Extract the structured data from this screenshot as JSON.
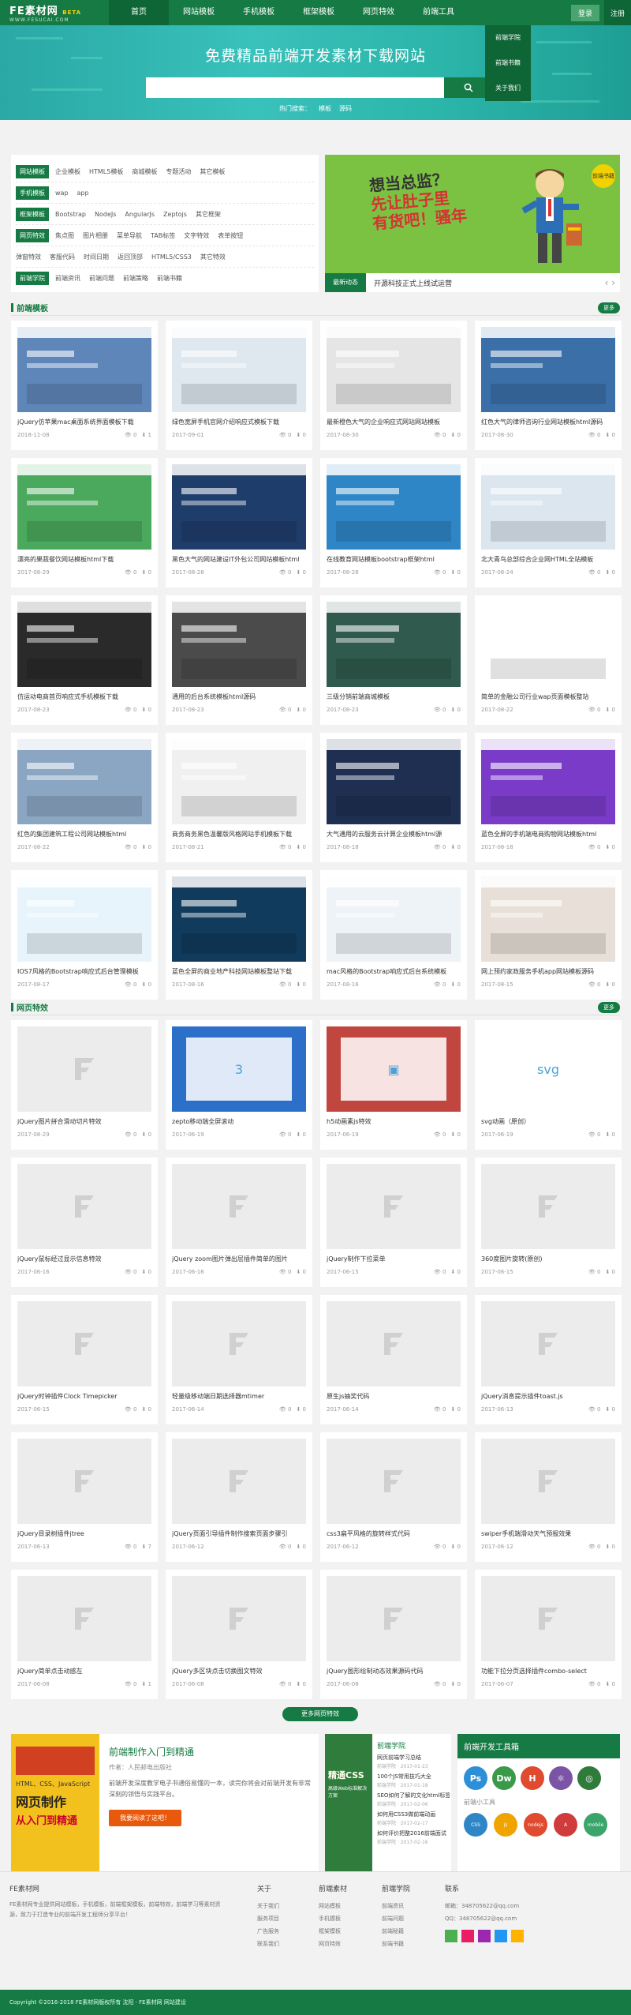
{
  "header": {
    "logo_main": "FE素材网",
    "logo_badge": "BETA",
    "logo_sub": "WWW.FESUCAI.COM",
    "nav": [
      "首页",
      "网站模板",
      "手机模板",
      "框架模板",
      "网页特效",
      "前端工具"
    ],
    "login": "登录",
    "register": "注册",
    "dropdown": [
      "前端学院",
      "前端书籍",
      "关于我们"
    ]
  },
  "banner": {
    "title": "免费精品前端开发素材下载网站",
    "search_placeholder": "",
    "hot_label": "热门搜索：",
    "hot": [
      "模板",
      "源码"
    ]
  },
  "tags": {
    "r1_label": "网站模板",
    "r1": [
      "企业模板",
      "HTML5模板",
      "商城模板",
      "专题活动",
      "其它模板"
    ],
    "r2_label": "手机模板",
    "r2": [
      "wap",
      "app"
    ],
    "r3_label": "框架模板",
    "r3": [
      "Bootstrap",
      "NodeJs",
      "AngularJs",
      "Zeptojs",
      "其它框架"
    ],
    "r4_label": "网页特效",
    "r4": [
      "焦点图",
      "图片相册",
      "菜单导航",
      "TAB标签",
      "文字特效",
      "表单按钮"
    ],
    "r5": [
      "弹窗特效",
      "客服代码",
      "时间日期",
      "返回顶部",
      "HTML5/CSS3",
      "其它特效"
    ],
    "r6_label": "前端学院",
    "r6": [
      "前端资讯",
      "前端问题",
      "前端策略",
      "前端书籍"
    ]
  },
  "promo": {
    "line1": "想当总监？",
    "line2": "先让肚子里",
    "line3": "有货吧！骚年",
    "badge": "前端书籍"
  },
  "news": {
    "label": "最新动态",
    "text": "开源科技正式上线试运营"
  },
  "sec1": {
    "title": "前端模板",
    "more": "更多"
  },
  "sec2": {
    "title": "网页特效",
    "more": "更多"
  },
  "templates": [
    {
      "t": "jQuery仿苹果mac桌面系统界面模板下载",
      "d": "2018-11-08",
      "v": "0",
      "l": "1",
      "c": "#5e86b8"
    },
    {
      "t": "绿色宽屏手机官网介绍响应式模板下载",
      "d": "2017-09-01",
      "v": "0",
      "l": "0",
      "c": "#dfe8ef"
    },
    {
      "t": "最新橙色大气的企业响应式网站网站模板",
      "d": "2017-08-30",
      "v": "0",
      "l": "0",
      "c": "#e5e5e5"
    },
    {
      "t": "红色大气的律师咨询行业网站模板html源码",
      "d": "2017-08-30",
      "v": "0",
      "l": "0",
      "c": "#3b6fa8"
    },
    {
      "t": "漂亮的果蔬餐饮网站模板html下载",
      "d": "2017-08-29",
      "v": "0",
      "l": "0",
      "c": "#4aa95c"
    },
    {
      "t": "黑色大气的网站建设IT外包公司网站模板html",
      "d": "2017-08-28",
      "v": "0",
      "l": "0",
      "c": "#1f3d6b"
    },
    {
      "t": "在线教育网站模板bootstrap框架html",
      "d": "2017-08-28",
      "v": "0",
      "l": "0",
      "c": "#2e86c7"
    },
    {
      "t": "北大青鸟总部综合企业网HTML全站模板",
      "d": "2017-08-24",
      "v": "0",
      "l": "0",
      "c": "#dce6ef"
    },
    {
      "t": "仿运动电商首页响应式手机模板下载",
      "d": "2017-08-23",
      "v": "0",
      "l": "0",
      "c": "#2a2a2a"
    },
    {
      "t": "通用的后台系统模板html源码",
      "d": "2017-08-23",
      "v": "0",
      "l": "0",
      "c": "#4b4b4b"
    },
    {
      "t": "三级分销前端商城模板",
      "d": "2017-08-23",
      "v": "0",
      "l": "0",
      "c": "#2f5a4d"
    },
    {
      "t": "简单的金融公司行业wap页面模板整站",
      "d": "2017-08-22",
      "v": "0",
      "l": "0",
      "c": "#ffffff"
    },
    {
      "t": "红色的集团建筑工程公司网站模板html",
      "d": "2017-08-22",
      "v": "0",
      "l": "0",
      "c": "#8aa6c2"
    },
    {
      "t": "商务商务黑色温馨版风格网站手机模板下载",
      "d": "2017-08-21",
      "v": "0",
      "l": "0",
      "c": "#f0f0f0"
    },
    {
      "t": "大气通用的云服务云计算企业模板html源",
      "d": "2017-08-18",
      "v": "0",
      "l": "0",
      "c": "#1e2f52"
    },
    {
      "t": "蓝色全屏的手机端电商购物网站模板html",
      "d": "2017-08-18",
      "v": "0",
      "l": "0",
      "c": "#7a3cc8"
    },
    {
      "t": "IOS7风格的Bootstrap响应式后台管理模板",
      "d": "2017-08-17",
      "v": "0",
      "l": "0",
      "c": "#e8f4fb"
    },
    {
      "t": "蓝色全屏的商业地产科技网站模板整站下载",
      "d": "2017-08-16",
      "v": "0",
      "l": "0",
      "c": "#113b5c"
    },
    {
      "t": "mac风格的Bootstrap响应式后台系统模板",
      "d": "2017-08-16",
      "v": "0",
      "l": "0",
      "c": "#eef3f8"
    },
    {
      "t": "网上预约家政服务手机app网站模板源码",
      "d": "2017-08-15",
      "v": "0",
      "l": "0",
      "c": "#e8e0d8"
    }
  ],
  "effects": [
    {
      "t": "jQuery图片拼合滑动切片特效",
      "d": "2017-08-29",
      "v": "0",
      "l": "0",
      "c": "#ececec",
      "ph": true
    },
    {
      "t": "zepto移动端全屏滚动",
      "d": "2017-06-19",
      "v": "0",
      "l": "0",
      "c": "#2b6fc9",
      "ph": false
    },
    {
      "t": "h5动画素js特效",
      "d": "2017-06-19",
      "v": "0",
      "l": "0",
      "c": "#c0463f",
      "ph": false
    },
    {
      "t": "svg动画（原创）",
      "d": "2017-06-19",
      "v": "0",
      "l": "0",
      "c": "#ffffff",
      "ph": false
    },
    {
      "t": "jQuery鼠标经过显示信息特效",
      "d": "2017-06-16",
      "v": "0",
      "l": "0",
      "c": "#ececec",
      "ph": true
    },
    {
      "t": "jQuery zoom图片弹出层插件简单的图片",
      "d": "2017-06-16",
      "v": "0",
      "l": "0",
      "c": "#ececec",
      "ph": true
    },
    {
      "t": "jQuery制作下拉菜单",
      "d": "2017-06-15",
      "v": "0",
      "l": "0",
      "c": "#ececec",
      "ph": true
    },
    {
      "t": "360度图片旋转(原创)",
      "d": "2017-06-15",
      "v": "0",
      "l": "0",
      "c": "#ececec",
      "ph": true
    },
    {
      "t": "jQuery时钟插件Clock Timepicker",
      "d": "2017-06-15",
      "v": "0",
      "l": "0",
      "c": "#ececec",
      "ph": true
    },
    {
      "t": "轻量级移动端日期选择器mtimer",
      "d": "2017-06-14",
      "v": "0",
      "l": "0",
      "c": "#ececec",
      "ph": true
    },
    {
      "t": "原生js抽奖代码",
      "d": "2017-06-14",
      "v": "0",
      "l": "0",
      "c": "#ececec",
      "ph": true
    },
    {
      "t": "jQuery消息提示插件toast.js",
      "d": "2017-06-13",
      "v": "0",
      "l": "0",
      "c": "#ececec",
      "ph": true
    },
    {
      "t": "jQuery目录树插件jtree",
      "d": "2017-06-13",
      "v": "0",
      "l": "7",
      "c": "#ececec",
      "ph": true
    },
    {
      "t": "jQuery页面引导插件制作搜索页面步骤引",
      "d": "2017-06-12",
      "v": "0",
      "l": "0",
      "c": "#ececec",
      "ph": true
    },
    {
      "t": "css3扁平风格的旋转样式代码",
      "d": "2017-06-12",
      "v": "0",
      "l": "0",
      "c": "#ececec",
      "ph": true
    },
    {
      "t": "swiper手机端滑动天气预报效果",
      "d": "2017-06-12",
      "v": "0",
      "l": "0",
      "c": "#ececec",
      "ph": true
    },
    {
      "t": "jQuery简单点击动感左",
      "d": "2017-06-08",
      "v": "0",
      "l": "1",
      "c": "#ececec",
      "ph": true
    },
    {
      "t": "jQuery多区块点击切换图文特效",
      "d": "2017-06-08",
      "v": "0",
      "l": "0",
      "c": "#ececec",
      "ph": true
    },
    {
      "t": "jQuery图形绘制动态效果源码代码",
      "d": "2017-06-08",
      "v": "0",
      "l": "0",
      "c": "#ececec",
      "ph": true
    },
    {
      "t": "功能下拉分页选择插件combo-select",
      "d": "2017-06-07",
      "v": "0",
      "l": "0",
      "c": "#ececec",
      "ph": true
    }
  ],
  "more_effects": "更多网页特效",
  "book": {
    "title": "前端制作入门到精通",
    "author": "作者：人民邮电出版社",
    "desc": "前端开发深度教学电子书通俗易懂的一本，读完你将会对前端开发有非常深刻的领悟与实践平台。",
    "btn": "我要阅读了这吧！",
    "cover1": "HTML、CSS、JavaScript",
    "cover2": "网页制作",
    "cover3": "从入门到精通"
  },
  "book2": {
    "title": "前端学院",
    "items": [
      "网页前端学习总结",
      "100个JS常用技巧大全",
      "SEO如何了解的文化html标签",
      "如何用CSS3做前端动画",
      "如何评价把整2016前端面试"
    ],
    "dates": [
      "前端学院 · 2017-01-23",
      "前端学院 · 2017-01-18",
      "前端学院 · 2017-02-06",
      "前端学院 · 2017-02-17",
      "前端学院 · 2017-02-16"
    ],
    "cover": "精通CSS",
    "cover2": "高级Web标准解决方案"
  },
  "tools": {
    "title": "前端开发工具箱",
    "sub": "前端小工具",
    "icons": [
      {
        "n": "Ps",
        "c": "#2d8fd8"
      },
      {
        "n": "Dw",
        "c": "#3a9a4a"
      },
      {
        "n": "H",
        "c": "#e04a2e"
      },
      {
        "n": "⚛",
        "c": "#7b54a6"
      },
      {
        "n": "◎",
        "c": "#2e7b3a"
      }
    ],
    "small": [
      {
        "n": "CSS",
        "c": "#2e86c7"
      },
      {
        "n": "js",
        "c": "#f0a400"
      },
      {
        "n": "nodejs",
        "c": "#e04a2e"
      },
      {
        "n": "A",
        "c": "#d03c3c"
      },
      {
        "n": "mobile",
        "c": "#3aa56a"
      }
    ]
  },
  "footer": {
    "c1_title": "FE素材网",
    "c1_text": "FE素材网专业提供网站模板，手机模板，前端框架模板，前端特效，前端学习等素材资源，致力于打造专业的前端开发工程师分享平台！",
    "c2_title": "关于",
    "c2": [
      "关于我们",
      "服务项目",
      "广告服务",
      "联系我们"
    ],
    "c3_title": "前端素材",
    "c3": [
      "网站模板",
      "手机模板",
      "框架模板",
      "网页特效"
    ],
    "c4_title": "前端学院",
    "c4": [
      "前端资讯",
      "前端问题",
      "前端秘籍",
      "前端书籍"
    ],
    "c5_title": "联系",
    "c5": [
      "邮箱：348705622@qq.com",
      "QQ：348705622@qq.com"
    ]
  },
  "copyright": "Copyright ©2016-2018 FE素材网版权所有  沈阳 · FE素材网 网站建设"
}
